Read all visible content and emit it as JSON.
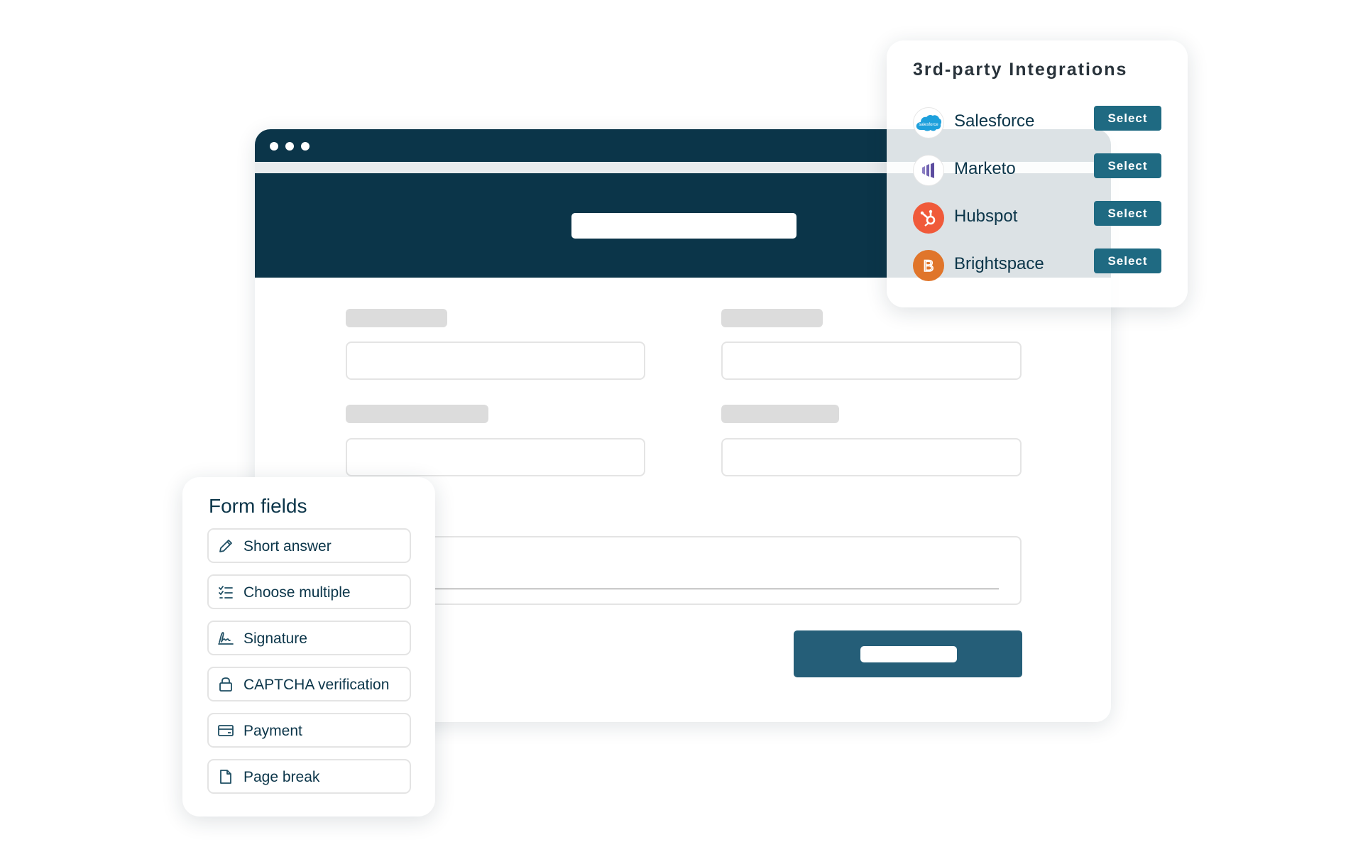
{
  "integrations": {
    "title": "3rd-party Integrations",
    "items": [
      {
        "name": "Salesforce",
        "logo_text": "salesforce",
        "icon": "salesforce-logo-icon",
        "color": "#1ea0dc",
        "button": "Select"
      },
      {
        "name": "Marketo",
        "icon": "marketo-logo-icon",
        "color": "#5c4c9f",
        "button": "Select"
      },
      {
        "name": "Hubspot",
        "icon": "hubspot-logo-icon",
        "color": "#f05a3a",
        "button": "Select"
      },
      {
        "name": "Brightspace",
        "logo_text": "B",
        "icon": "brightspace-logo-icon",
        "color": "#e0752a",
        "button": "Select"
      }
    ]
  },
  "form_fields": {
    "title": "Form fields",
    "items": [
      {
        "label": "Short answer",
        "icon": "pencil-icon"
      },
      {
        "label": "Choose multiple",
        "icon": "checklist-icon"
      },
      {
        "label": "Signature",
        "icon": "signature-icon"
      },
      {
        "label": "CAPTCHA verification",
        "icon": "lock-icon"
      },
      {
        "label": "Payment",
        "icon": "credit-card-icon"
      },
      {
        "label": "Page break",
        "icon": "document-icon"
      }
    ]
  },
  "colors": {
    "navy": "#0b3549",
    "accent": "#1f6a82",
    "submit": "#255e78"
  }
}
